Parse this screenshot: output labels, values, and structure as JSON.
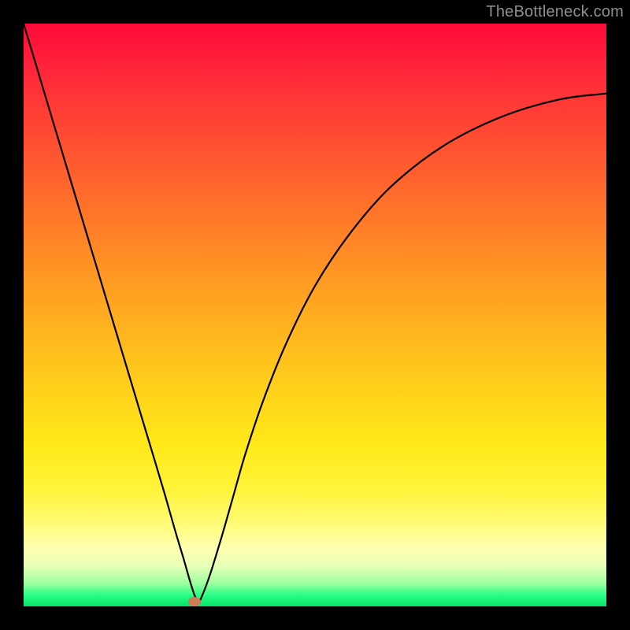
{
  "watermark": "TheBottleneck.com",
  "colors": {
    "curve_stroke": "#000000",
    "dot_fill": "#d07a58",
    "frame_bg": "#000000"
  },
  "chart_data": {
    "type": "line",
    "title": "",
    "xlabel": "",
    "ylabel": "",
    "xlim": [
      0,
      1
    ],
    "ylim": [
      0,
      1
    ],
    "grid": false,
    "legend": false,
    "series": [
      {
        "name": "curve",
        "x": [
          0.0,
          0.03,
          0.06,
          0.09,
          0.12,
          0.15,
          0.18,
          0.21,
          0.24,
          0.26,
          0.275,
          0.285,
          0.293,
          0.3,
          0.307,
          0.32,
          0.34,
          0.36,
          0.38,
          0.41,
          0.45,
          0.5,
          0.56,
          0.63,
          0.72,
          0.82,
          0.92,
          1.0
        ],
        "y": [
          1.0,
          0.9,
          0.8,
          0.7,
          0.6,
          0.5,
          0.4,
          0.3,
          0.2,
          0.13,
          0.08,
          0.045,
          0.02,
          0.008,
          0.02,
          0.055,
          0.12,
          0.19,
          0.26,
          0.35,
          0.45,
          0.55,
          0.64,
          0.72,
          0.79,
          0.84,
          0.87,
          0.88
        ]
      }
    ],
    "marker": {
      "x": 0.293,
      "y": 0.008
    }
  }
}
